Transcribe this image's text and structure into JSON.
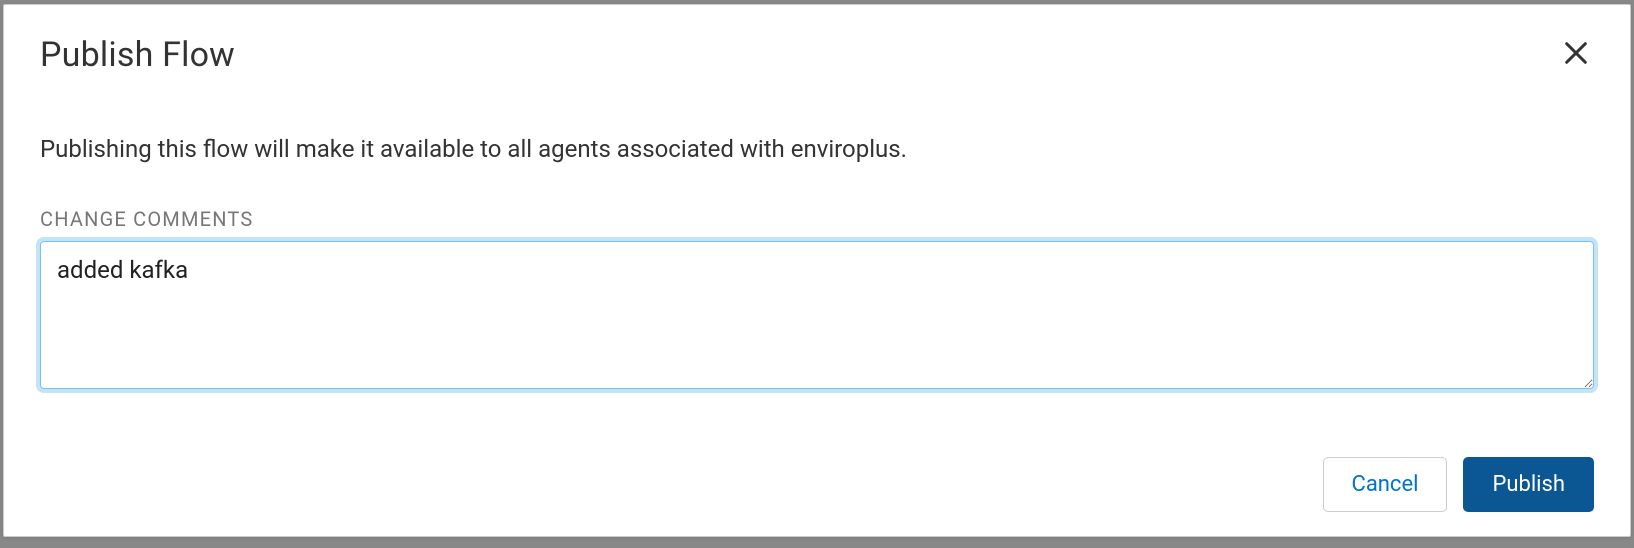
{
  "dialog": {
    "title": "Publish Flow",
    "description": "Publishing this flow will make it available to all agents associated with enviroplus.",
    "comments_label": "CHANGE COMMENTS",
    "comments_value": "added kafka",
    "cancel_label": "Cancel",
    "publish_label": "Publish"
  }
}
